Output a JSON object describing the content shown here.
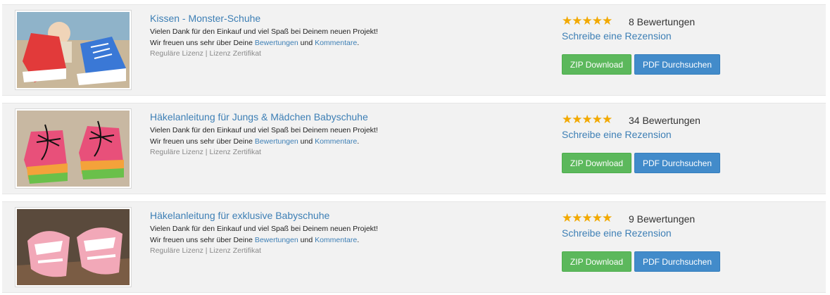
{
  "products": [
    {
      "title": "Kissen - Monster-Schuhe",
      "thanks_line": "Vielen Dank für den Einkauf und viel Spaß bei Deinem neuen Projekt!",
      "feedback_prefix": "Wir freuen uns sehr über Deine ",
      "reviews_link": "Bewertungen",
      "and_word": " und ",
      "comments_link": "Kommentare",
      "period": ".",
      "license_regular": "Reguläre Lizenz",
      "license_separator": " | ",
      "license_certificate": "Lizenz Zertifikat",
      "stars": "★★★★★",
      "rating_count": "8 Bewertungen",
      "write_review": "Schreibe eine Rezension",
      "zip_label": "ZIP Download",
      "pdf_label": "PDF Durchsuchen",
      "image_icon": "crochet-sneakers-photo"
    },
    {
      "title": "Häkelanleitung für Jungs & Mädchen Babyschuhe",
      "thanks_line": "Vielen Dank für den Einkauf und viel Spaß bei Deinem neuen Projekt!",
      "feedback_prefix": "Wir freuen uns sehr über Deine ",
      "reviews_link": "Bewertungen",
      "and_word": " und ",
      "comments_link": "Kommentare",
      "period": ".",
      "license_regular": "Reguläre Lizenz",
      "license_separator": " | ",
      "license_certificate": "Lizenz Zertifikat",
      "stars": "★★★★★",
      "rating_count": "34 Bewertungen",
      "write_review": "Schreibe eine Rezension",
      "zip_label": "ZIP Download",
      "pdf_label": "PDF Durchsuchen",
      "image_icon": "baby-booties-photo"
    },
    {
      "title": "Häkelanleitung für exklusive Babyschuhe",
      "thanks_line": "Vielen Dank für den Einkauf und viel Spaß bei Deinem neuen Projekt!",
      "feedback_prefix": "Wir freuen uns sehr über Deine ",
      "reviews_link": "Bewertungen",
      "and_word": " und ",
      "comments_link": "Kommentare",
      "period": ".",
      "license_regular": "Reguläre Lizenz",
      "license_separator": " | ",
      "license_certificate": "Lizenz Zertifikat",
      "stars": "★★★★★",
      "rating_count": "9 Bewertungen",
      "write_review": "Schreibe eine Rezension",
      "zip_label": "ZIP Download",
      "pdf_label": "PDF Durchsuchen",
      "image_icon": "baby-sandals-photo"
    }
  ],
  "colors": {
    "link": "#3d7fb5",
    "star": "#f2a900",
    "zip_button": "#5cb85c",
    "pdf_button": "#428bca",
    "row_background": "#f2f2f2"
  }
}
